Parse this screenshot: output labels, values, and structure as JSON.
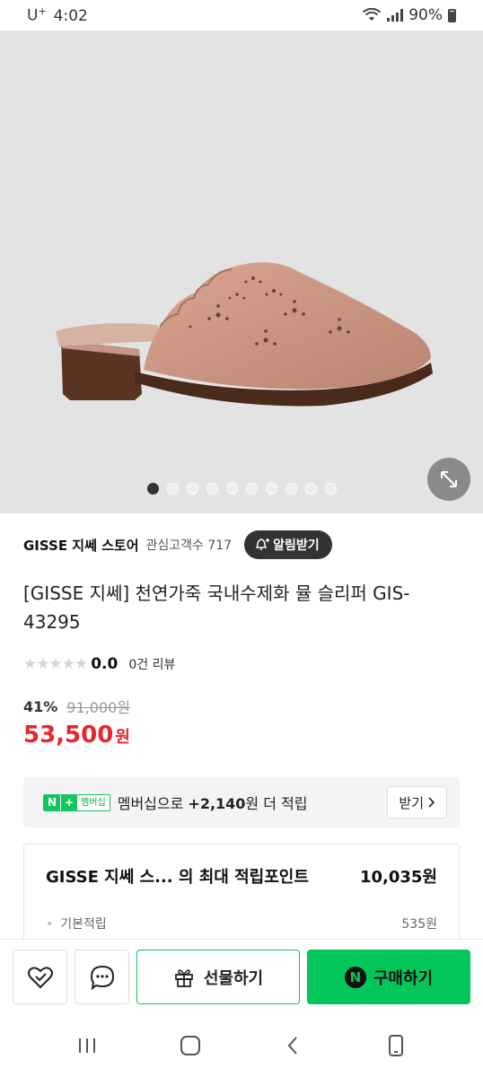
{
  "status_bar": {
    "carrier": "U",
    "carrier_sup": "+",
    "time": "4:02",
    "battery": "90%"
  },
  "gallery": {
    "dot_count": 10,
    "active_index": 0
  },
  "store": {
    "name": "GISSE 지쎄 스토어",
    "fans": "관심고객수 717",
    "notify_label": "알림받기"
  },
  "product": {
    "title": "[GISSE 지쎄] 천연가죽 국내수제화 뮬 슬리퍼 GIS-43295",
    "stars": "★★★★★",
    "score": "0.0",
    "reviews": "0건 리뷰",
    "discount": "41%",
    "original_price": "91,000원",
    "price": "53,500",
    "currency": "원"
  },
  "membership": {
    "badge_n": "N",
    "badge_plus": "+",
    "badge_label": "멤버십",
    "text_prefix": "멤버십으로 ",
    "points": "+2,140",
    "text_suffix": "원 더 적립",
    "receive_label": "받기"
  },
  "points_card": {
    "heading": "GISSE 지쎄 스...  의 최대 적립포인트",
    "total": "10,035원",
    "rows": [
      {
        "label": "기본적립",
        "value": "535원"
      }
    ]
  },
  "actions": {
    "gift_label": "선물하기",
    "buy_n": "N",
    "buy_label": "구매하기"
  },
  "colors": {
    "accent_green": "#03c75a",
    "price_red": "#e8262d",
    "hero_bg": "#e3e3e3"
  }
}
